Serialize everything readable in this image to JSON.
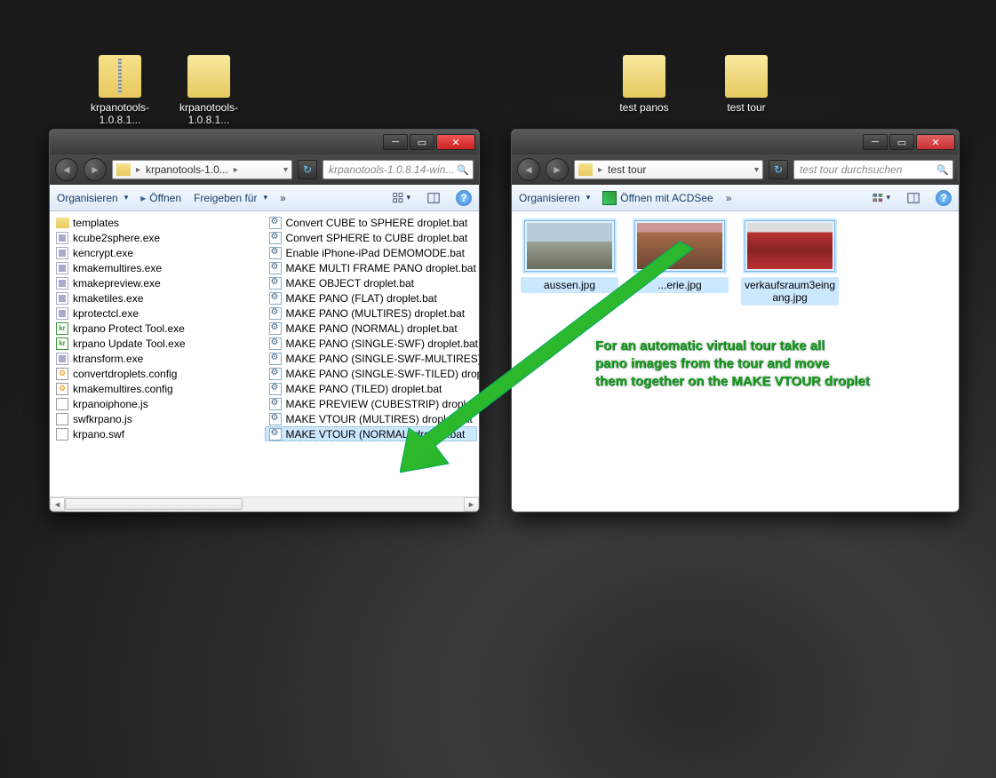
{
  "desktop_icons": [
    {
      "label": "krpanotools-1.0.8.1...",
      "type": "zip"
    },
    {
      "label": "krpanotools-1.0.8.1...",
      "type": "folder-open"
    },
    {
      "label": "test panos",
      "type": "folder-open"
    },
    {
      "label": "test tour",
      "type": "folder-open"
    }
  ],
  "window1": {
    "breadcrumb": "krpanotools-1.0...",
    "search_placeholder": "krpanotools-1.0.8.14-win...",
    "toolbar": {
      "organize": "Organisieren",
      "open": "Öffnen",
      "share": "Freigeben für"
    },
    "col1": [
      {
        "icon": "folder",
        "name": "templates"
      },
      {
        "icon": "exe",
        "name": "kcube2sphere.exe"
      },
      {
        "icon": "exe",
        "name": "kencrypt.exe"
      },
      {
        "icon": "exe",
        "name": "kmakemultires.exe"
      },
      {
        "icon": "exe",
        "name": "kmakepreview.exe"
      },
      {
        "icon": "exe",
        "name": "kmaketiles.exe"
      },
      {
        "icon": "exe",
        "name": "kprotectcl.exe"
      },
      {
        "icon": "kr",
        "name": "krpano Protect Tool.exe"
      },
      {
        "icon": "kr",
        "name": "krpano Update Tool.exe"
      },
      {
        "icon": "exe",
        "name": "ktransform.exe"
      },
      {
        "icon": "config",
        "name": "convertdroplets.config"
      },
      {
        "icon": "config",
        "name": "kmakemultires.config"
      },
      {
        "icon": "js",
        "name": "krpanoiphone.js"
      },
      {
        "icon": "js",
        "name": "swfkrpano.js"
      },
      {
        "icon": "swf",
        "name": "krpano.swf"
      }
    ],
    "col2": [
      {
        "icon": "bat",
        "name": "Convert CUBE to SPHERE droplet.bat"
      },
      {
        "icon": "bat",
        "name": "Convert SPHERE to CUBE droplet.bat"
      },
      {
        "icon": "bat",
        "name": "Enable iPhone-iPad DEMOMODE.bat"
      },
      {
        "icon": "bat",
        "name": "MAKE MULTI FRAME PANO droplet.bat"
      },
      {
        "icon": "bat",
        "name": "MAKE OBJECT droplet.bat"
      },
      {
        "icon": "bat",
        "name": "MAKE PANO (FLAT) droplet.bat"
      },
      {
        "icon": "bat",
        "name": "MAKE PANO (MULTIRES) droplet.bat"
      },
      {
        "icon": "bat",
        "name": "MAKE PANO (NORMAL) droplet.bat"
      },
      {
        "icon": "bat",
        "name": "MAKE PANO (SINGLE-SWF) droplet.bat"
      },
      {
        "icon": "bat",
        "name": "MAKE PANO (SINGLE-SWF-MULTIRES) droplet.bat"
      },
      {
        "icon": "bat",
        "name": "MAKE PANO (SINGLE-SWF-TILED) droplet.bat"
      },
      {
        "icon": "bat",
        "name": "MAKE PANO (TILED) droplet.bat"
      },
      {
        "icon": "bat",
        "name": "MAKE PREVIEW (CUBESTRIP) droplet.bat"
      },
      {
        "icon": "bat",
        "name": "MAKE VTOUR (MULTIRES) droplet.bat"
      },
      {
        "icon": "bat",
        "name": "MAKE VTOUR (NORMAL) droplet.bat",
        "selected": true
      }
    ]
  },
  "window2": {
    "breadcrumb": "test tour",
    "search_placeholder": "test tour durchsuchen",
    "toolbar": {
      "organize": "Organisieren",
      "open": "Öffnen mit ACDSee"
    },
    "thumbs": [
      {
        "name": "aussen.jpg",
        "sel": true,
        "grad": "linear-gradient(#b7ccd9 40%, #9aa496 40%, #6b6b5a)"
      },
      {
        "name": "...erie.jpg",
        "sel": true,
        "grad": "linear-gradient(#c99 20%, #a76b4a 20%, #6b4732)"
      },
      {
        "name": "verkaufsraum3eingang.jpg",
        "sel": true,
        "grad": "linear-gradient(#ddd 20%, #b33 20%, #822 60%, #b33)"
      }
    ]
  },
  "annotation": {
    "line1": "For an automatic virtual tour take all",
    "line2": "pano images from the tour and move",
    "line3": "them together on the MAKE VTOUR droplet"
  }
}
